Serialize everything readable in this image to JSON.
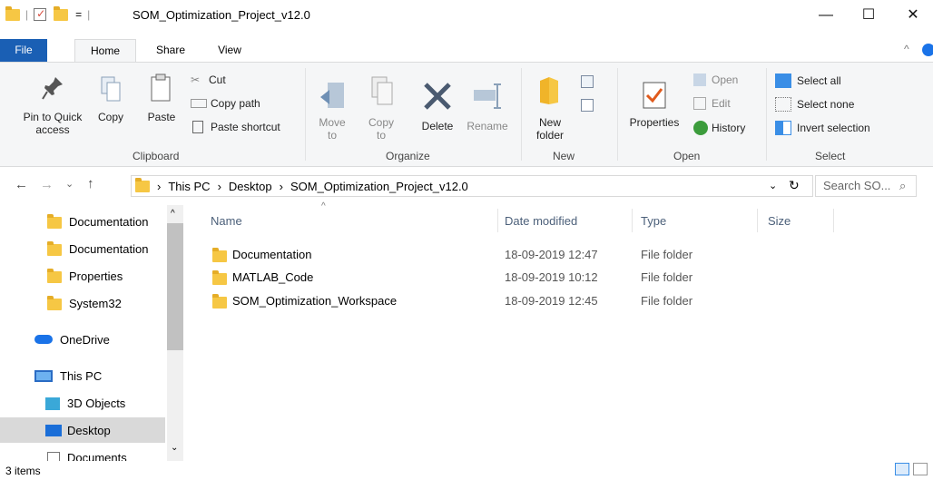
{
  "window": {
    "title": "SOM_Optimization_Project_v12.0",
    "controls": [
      "—",
      "☐",
      "✕"
    ]
  },
  "ribbon": {
    "tabs": [
      "File",
      "Home",
      "Share",
      "View"
    ],
    "clipboard": {
      "label": "Clipboard",
      "pin": "Pin to Quick access",
      "copy": "Copy",
      "paste": "Paste",
      "cut": "Cut",
      "copy_path": "Copy path",
      "paste_shortcut": "Paste shortcut"
    },
    "organize": {
      "label": "Organize",
      "move_to": "Move to",
      "copy_to": "Copy to",
      "delete": "Delete",
      "rename": "Rename"
    },
    "new": {
      "label": "New",
      "new_folder": "New folder"
    },
    "open": {
      "label": "Open",
      "properties": "Properties",
      "open": "Open",
      "edit": "Edit",
      "history": "History"
    },
    "select": {
      "label": "Select",
      "select_all": "Select all",
      "select_none": "Select none",
      "invert": "Invert selection"
    }
  },
  "address": {
    "crumbs": [
      "This PC",
      "Desktop",
      "SOM_Optimization_Project_v12.0"
    ],
    "search_placeholder": "Search SO..."
  },
  "nav": {
    "items": [
      "Documentation",
      "Documentation",
      "Properties",
      "System32",
      "OneDrive",
      "This PC",
      "3D Objects",
      "Desktop",
      "Documents"
    ]
  },
  "columns": [
    "Name",
    "Date modified",
    "Type",
    "Size"
  ],
  "files": [
    {
      "name": "Documentation",
      "date": "18-09-2019 12:47",
      "type": "File folder"
    },
    {
      "name": "MATLAB_Code",
      "date": "18-09-2019 10:12",
      "type": "File folder"
    },
    {
      "name": "SOM_Optimization_Workspace",
      "date": "18-09-2019 12:45",
      "type": "File folder"
    }
  ],
  "status": {
    "count": "3 items"
  },
  "colors": {
    "file_tab": "#1a5fb4",
    "folder": "#f6c744",
    "selected_nav": "#d9d9d9"
  }
}
